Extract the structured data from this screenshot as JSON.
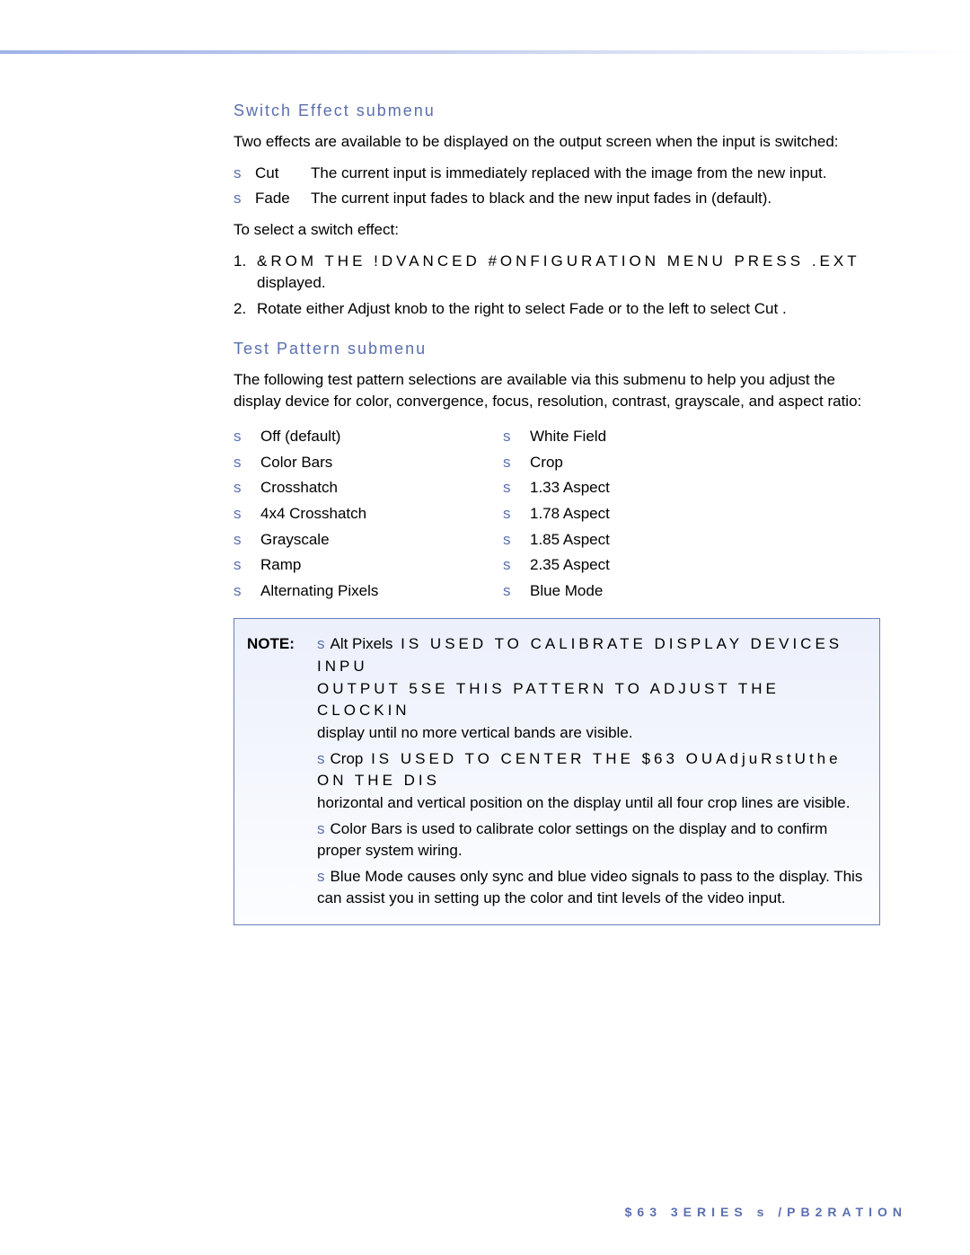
{
  "section1": {
    "heading": "Switch Effect submenu",
    "intro": "Two effects are available to be displayed on the output screen when the input is switched:",
    "options": [
      {
        "term": "Cut",
        "desc": "The current input is immediately replaced with the image from the new input."
      },
      {
        "term": "Fade",
        "desc": "The current input fades to black and the new input fades in (default)."
      }
    ],
    "lead": "To select a switch effect:",
    "steps": [
      {
        "n": "1.",
        "line1": "&ROM THE !DVANCED #ONFIGURATION MENU  PRESS .EXT",
        "line2": "displayed."
      },
      {
        "n": "2.",
        "line1": "Rotate either Adjust knob to the right to select Fade or to the left to select Cut ."
      }
    ]
  },
  "section2": {
    "heading": "Test Pattern submenu",
    "intro": "The following test pattern selections are available via this submenu to help you adjust the display device for color, convergence, focus, resolution, contrast, grayscale, and aspect ratio:",
    "col1": [
      "Off (default)",
      "Color Bars",
      "Crosshatch",
      "4x4 Crosshatch",
      "Grayscale",
      "Ramp",
      "Alternating   Pixels"
    ],
    "col2": [
      "White Field",
      "Crop",
      "1.33 Aspect",
      "1.78 Aspect",
      "1.85 Aspect",
      "2.35 Aspect",
      "Blue Mode"
    ]
  },
  "note": {
    "label": "NOTE:",
    "items": [
      {
        "head": "Alt Pixels",
        "caps1": " IS USED TO CALIBRATE DISPLAY DEVICES INPU",
        "caps2": "OUTPUT  5SE THIS PATTERN TO ADJUST THE CLOCKIN",
        "tail": "display until no more vertical bands are visible."
      },
      {
        "head": "Crop",
        "caps1": " IS USED TO CENTER THE $63 OUAdjuRstUthe ON THE DIS",
        "tail": "horizontal and vertical position on the display until all four crop lines are visible."
      },
      {
        "head": "Color Bars",
        "plain": " is used to calibrate color settings on the display and to confirm proper system wiring."
      },
      {
        "head": "Blue Mode",
        "plain": " causes only sync and blue video signals to pass to the display. This can assist you in setting up the color and tint levels of the video input."
      }
    ]
  },
  "footer": "$63  3ERIES s /PB2RATION"
}
